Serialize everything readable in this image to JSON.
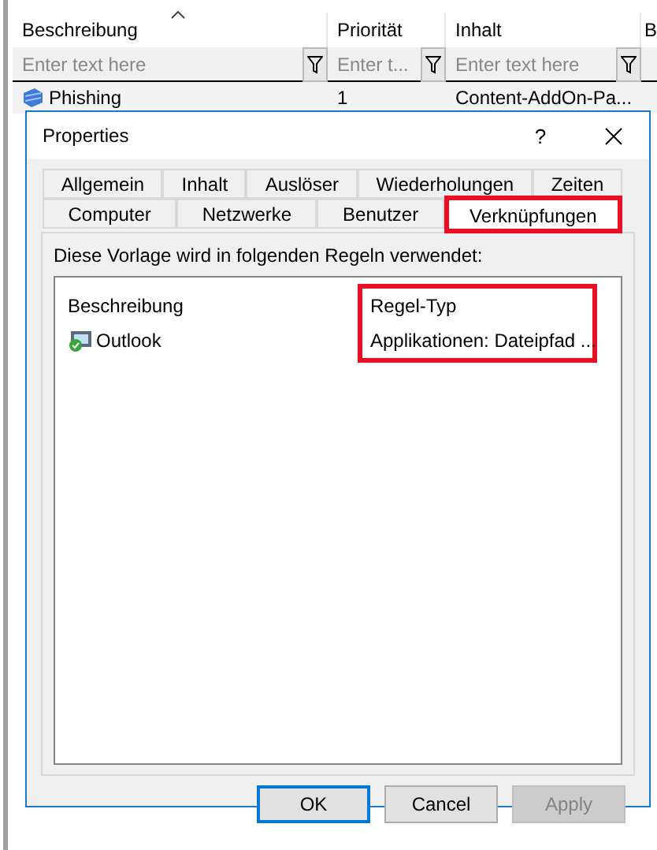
{
  "grid": {
    "columns": [
      {
        "label": "Beschreibung",
        "sorted": true,
        "filter_placeholder": "Enter text here"
      },
      {
        "label": "Priorität",
        "filter_placeholder": "Enter t..."
      },
      {
        "label": "Inhalt",
        "filter_placeholder": "Enter text here"
      },
      {
        "label": "B"
      }
    ],
    "rows": [
      {
        "cells": [
          "Phishing",
          "1",
          "Content-AddOn-Pa..."
        ]
      }
    ]
  },
  "dialog": {
    "title": "Properties",
    "help": "?",
    "tab_rows": [
      [
        {
          "label": "Allgemein",
          "selected": false,
          "highlighted": false
        },
        {
          "label": "Inhalt",
          "selected": false,
          "highlighted": false
        },
        {
          "label": "Auslöser",
          "selected": false,
          "highlighted": false
        },
        {
          "label": "Wiederholungen",
          "selected": false,
          "highlighted": false
        },
        {
          "label": "Zeiten",
          "selected": false,
          "highlighted": false
        }
      ],
      [
        {
          "label": "Computer",
          "selected": false,
          "highlighted": false
        },
        {
          "label": "Netzwerke",
          "selected": false,
          "highlighted": false
        },
        {
          "label": "Benutzer",
          "selected": false,
          "highlighted": false
        },
        {
          "label": "Verknüpfungen",
          "selected": true,
          "highlighted": true
        }
      ]
    ],
    "intro": "Diese Vorlage wird in folgenden Regeln verwendet:",
    "list": {
      "columns": [
        {
          "label": "Beschreibung",
          "highlighted": false
        },
        {
          "label": "Regel-Typ",
          "highlighted": true
        }
      ],
      "rows": [
        {
          "cells": [
            "Outlook",
            "Applikationen: Dateipfad ..."
          ]
        }
      ]
    },
    "buttons": [
      {
        "label": "OK",
        "default": true,
        "disabled": false
      },
      {
        "label": "Cancel",
        "default": false,
        "disabled": false
      },
      {
        "label": "Apply",
        "default": false,
        "disabled": true
      }
    ]
  }
}
